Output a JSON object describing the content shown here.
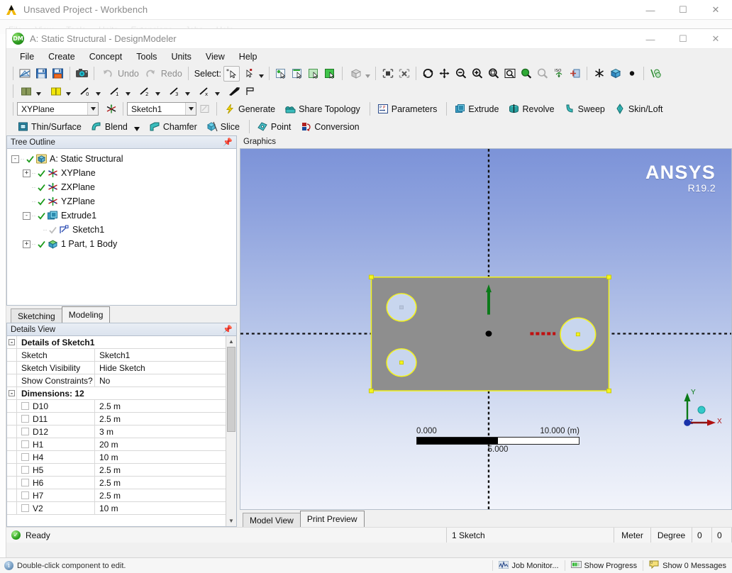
{
  "workbench": {
    "title": "Unsaved Project - Workbench",
    "menu": [
      "File",
      "View",
      "Tools",
      "Units",
      "Extensions",
      "Jobs",
      "Help"
    ],
    "window_buttons": {
      "minimize": "—",
      "maximize": "☐",
      "close": "✕"
    }
  },
  "designmodeler": {
    "title": "A: Static Structural - DesignModeler",
    "icon_text": "DM",
    "window_buttons": {
      "minimize": "—",
      "maximize": "☐",
      "close": "✕"
    },
    "menu": [
      "File",
      "Create",
      "Concept",
      "Tools",
      "Units",
      "View",
      "Help"
    ]
  },
  "toolbar_main": {
    "select_label": "Select:",
    "undo_label": "Undo",
    "redo_label": "Redo"
  },
  "toolbar_plane": {
    "plane_value": "XYPlane",
    "sketch_value": "Sketch1",
    "generate": "Generate",
    "share_topology": "Share Topology",
    "parameters": "Parameters",
    "extrude": "Extrude",
    "revolve": "Revolve",
    "sweep": "Sweep",
    "skin_loft": "Skin/Loft"
  },
  "toolbar_features": {
    "thin_surface": "Thin/Surface",
    "blend": "Blend",
    "chamfer": "Chamfer",
    "slice": "Slice",
    "point": "Point",
    "conversion": "Conversion"
  },
  "tree_panel": {
    "title": "Tree Outline",
    "items": [
      {
        "label": "A: Static Structural",
        "depth": 0,
        "expander": "-",
        "icon": "model-icon",
        "check": true
      },
      {
        "label": "XYPlane",
        "depth": 1,
        "expander": "+",
        "icon": "plane-icon",
        "check": true
      },
      {
        "label": "ZXPlane",
        "depth": 1,
        "expander": "",
        "icon": "plane-icon",
        "check": true
      },
      {
        "label": "YZPlane",
        "depth": 1,
        "expander": "",
        "icon": "plane-icon",
        "check": true
      },
      {
        "label": "Extrude1",
        "depth": 1,
        "expander": "-",
        "icon": "extrude-icon",
        "check": true
      },
      {
        "label": "Sketch1",
        "depth": 2,
        "expander": "",
        "icon": "sketch-icon",
        "check": true
      },
      {
        "label": "1 Part, 1 Body",
        "depth": 1,
        "expander": "+",
        "icon": "body-icon",
        "check": true
      }
    ],
    "tabs": [
      {
        "label": "Sketching",
        "active": false
      },
      {
        "label": "Modeling",
        "active": true
      }
    ]
  },
  "details_panel": {
    "title": "Details View",
    "groups": [
      {
        "header": "Details of Sketch1",
        "rows": [
          {
            "name": "Sketch",
            "value": "Sketch1"
          },
          {
            "name": "Sketch Visibility",
            "value": "Hide Sketch"
          },
          {
            "name": "Show Constraints?",
            "value": "No"
          }
        ]
      },
      {
        "header": "Dimensions: 12",
        "rows": [
          {
            "name": "D10",
            "value": "2.5 m",
            "checkbox": true
          },
          {
            "name": "D11",
            "value": "2.5 m",
            "checkbox": true
          },
          {
            "name": "D12",
            "value": "3 m",
            "checkbox": true
          },
          {
            "name": "H1",
            "value": "20 m",
            "checkbox": true
          },
          {
            "name": "H4",
            "value": "10 m",
            "checkbox": true
          },
          {
            "name": "H5",
            "value": "2.5 m",
            "checkbox": true
          },
          {
            "name": "H6",
            "value": "2.5 m",
            "checkbox": true
          },
          {
            "name": "H7",
            "value": "2.5 m",
            "checkbox": true
          },
          {
            "name": "V2",
            "value": "10 m",
            "checkbox": true
          }
        ]
      }
    ]
  },
  "graphics": {
    "title": "Graphics",
    "logo_main": "ANSYS",
    "logo_version": "R19.2",
    "scale": {
      "min": "0.000",
      "max": "10.000 (m)",
      "mid": "5.000"
    },
    "triad": {
      "x": "X",
      "y": "Y",
      "z": "Z"
    },
    "tabs": [
      {
        "label": "Model View",
        "active": true
      },
      {
        "label": "Print Preview",
        "active": false
      }
    ]
  },
  "statusbar": {
    "ready": "Ready",
    "sketch_count": "1 Sketch",
    "length_unit": "Meter",
    "angle_unit": "Degree",
    "num1": "0",
    "num2": "0"
  },
  "wb_statusbar": {
    "hint": "Double-click component to edit.",
    "job_monitor": "Job Monitor...",
    "show_progress": "Show Progress",
    "show_messages": "Show 0 Messages"
  }
}
